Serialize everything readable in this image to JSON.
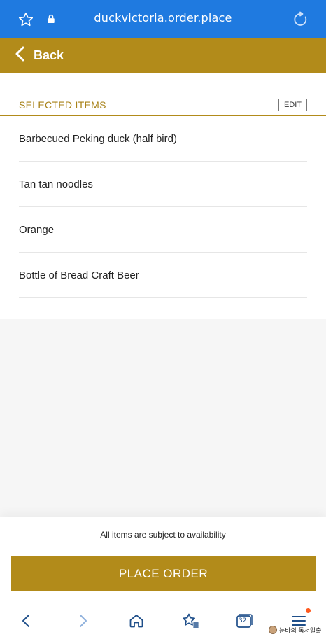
{
  "browser": {
    "url": "duckvictoria.order.place",
    "icons": {
      "bookmark": "star-icon",
      "security": "lock-icon",
      "reload": "refresh-icon"
    },
    "color": "#1f7ae0"
  },
  "header": {
    "back_label": "Back",
    "color": "#b28b1a"
  },
  "selected_items": {
    "title": "SELECTED ITEMS",
    "edit_label": "EDIT",
    "items": [
      {
        "name": "Barbecued Peking duck (half bird)"
      },
      {
        "name": "Tan tan noodles"
      },
      {
        "name": "Orange"
      },
      {
        "name": "Bottle of Bread Craft Beer"
      }
    ]
  },
  "footer": {
    "note": "All items are subject to availability",
    "place_order_label": "PLACE ORDER"
  },
  "bottom_nav": {
    "tab_count": "32",
    "icons": [
      "chevron-left-icon",
      "chevron-right-icon",
      "home-icon",
      "bookmarks-icon",
      "tabs-icon",
      "menu-icon"
    ]
  },
  "watermark": {
    "text": "눈바의 독서일출"
  }
}
